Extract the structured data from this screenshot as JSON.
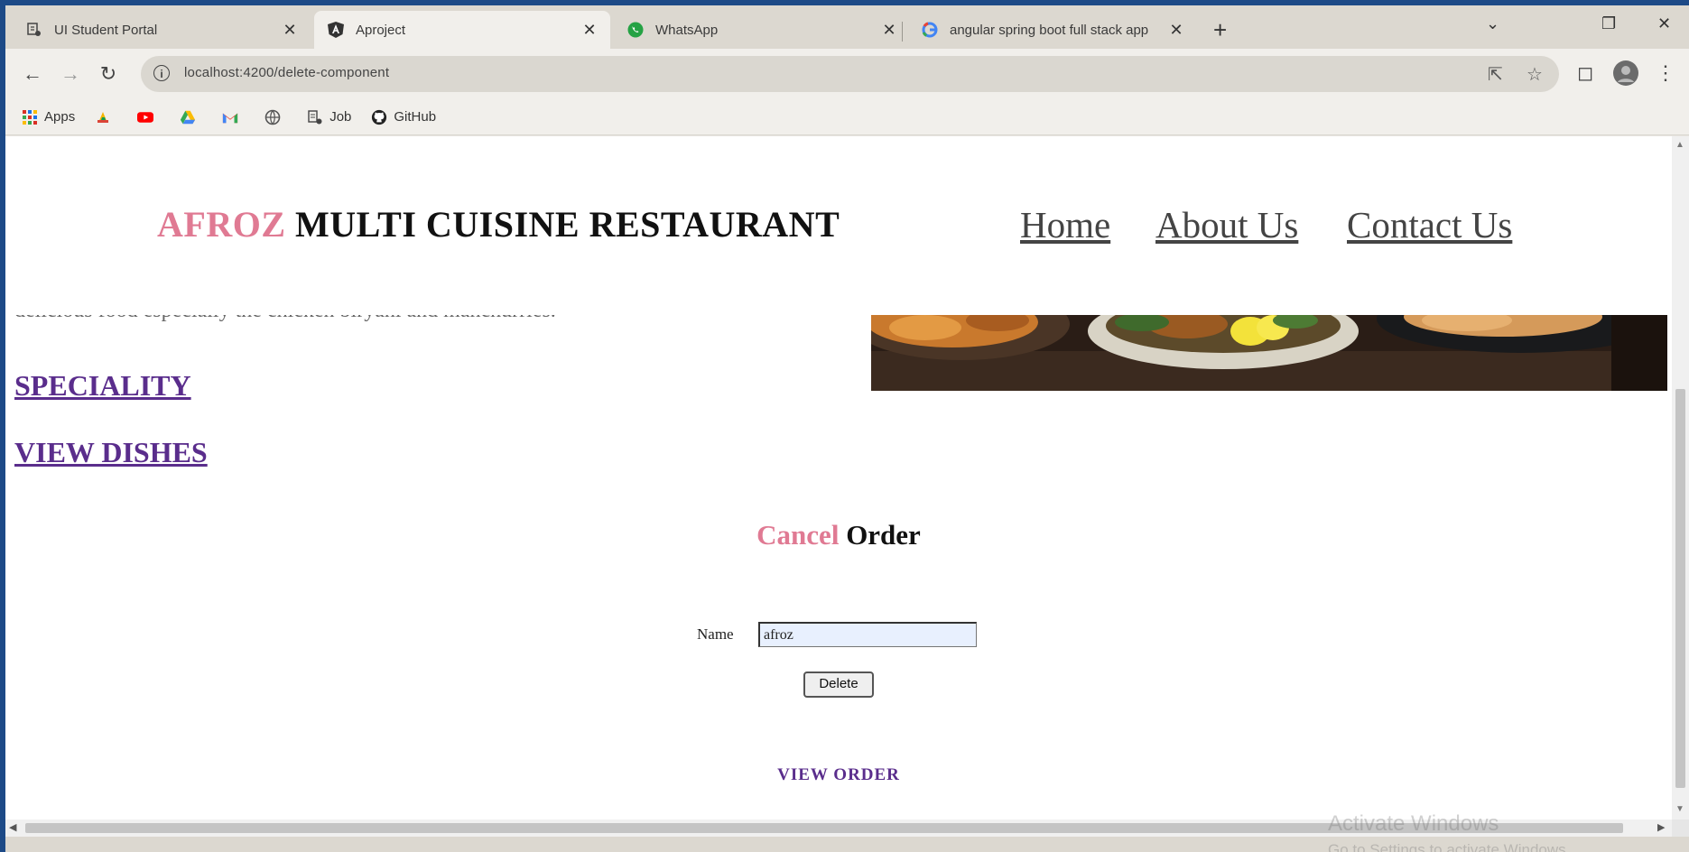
{
  "browser": {
    "tabs": [
      {
        "label": "UI Student Portal",
        "icon": "student-portal-icon"
      },
      {
        "label": "Aproject",
        "icon": "angular-icon"
      },
      {
        "label": "WhatsApp",
        "icon": "whatsapp-icon"
      },
      {
        "label": "angular spring boot full stack app",
        "icon": "google-icon"
      }
    ],
    "url": "localhost:4200/delete-component",
    "bookmarks": [
      {
        "label": "Apps",
        "icon": "apps-grid-icon"
      },
      {
        "label": "",
        "icon": "drive-folder-icon"
      },
      {
        "label": "",
        "icon": "youtube-icon"
      },
      {
        "label": "",
        "icon": "google-drive-icon"
      },
      {
        "label": "",
        "icon": "gmail-icon"
      },
      {
        "label": "",
        "icon": "globe-icon"
      },
      {
        "label": "Job",
        "icon": "job-icon"
      },
      {
        "label": "GitHub",
        "icon": "github-icon"
      }
    ]
  },
  "page": {
    "brand_accent": "AFROZ",
    "brand_rest": " MULTI CUISINE RESTAURANT",
    "nav": [
      "Home",
      "About Us",
      "Contact Us"
    ],
    "intro_text": "delicious food especially the chicken biryani and manchurries.",
    "speciality_link": "SPECIALITY",
    "view_dishes_link": "VIEW DISHES",
    "cancel_accent": "Cancel",
    "cancel_rest": " Order",
    "name_label": "Name",
    "name_value": "afroz",
    "delete_button": "Delete",
    "view_order_link": "VIEW ORDER"
  },
  "system": {
    "watermark_line1": "Activate Windows",
    "watermark_line2": "Go to Settings to activate Windows."
  },
  "colors": {
    "accent_pink": "#e07a93",
    "link_purple": "#5a2d8c",
    "taskbar_blue": "#1d4a87"
  }
}
